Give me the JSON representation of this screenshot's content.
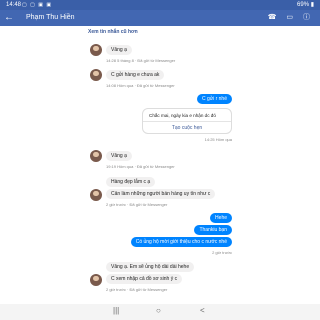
{
  "status": {
    "time": "14:48",
    "icons": "▢ ▢ ▣ ▣",
    "battery": "69% ▮"
  },
  "header": {
    "back_icon": "back-arrow-icon",
    "title": "Phạm Thu Hiền",
    "icons": "☎ ▭ ⓘ"
  },
  "older_link": "Xem tin nhắn cũ hơn",
  "messages": [
    {
      "text": "Vâng ạ",
      "meta": "14:28 5 tháng 8 · Đã gửi từ Messenger"
    },
    {
      "text": "C gửi hàng e chưa ak",
      "meta": "14:08 Hôm qua · Đã gửi từ Messenger"
    },
    {
      "text": "C gửi r nhé"
    },
    {
      "text": "Chắc mai, ngày kia e nhận dc đó",
      "meta": "14:25 Hôm qua"
    },
    {
      "text": "Tạo cuộc hẹn"
    },
    {
      "text": "Vâng ạ",
      "meta": "19:19 Hôm qua · Đã gửi từ Messenger"
    },
    {
      "text": "Hàng đẹp lắm c ạ"
    },
    {
      "text": "Cản làm những người bán hàng uy tín như c",
      "meta": "2 giờ trước · Đã gửi từ Messenger"
    },
    {
      "text": "Hehe"
    },
    {
      "text": "Thankiu bạn"
    },
    {
      "text": "Có ủng hộ mời giới thiệu cho c nước nhé",
      "meta": "2 giờ trước"
    },
    {
      "text": "Vâng ạ. Em sẽ ủng hộ dài dài hehe"
    },
    {
      "text": "C xem nhập cả đồ sơ sinh ý c",
      "meta": "2 giờ trước · Đã gửi từ Messenger"
    }
  ],
  "nav": {
    "recent": "|||",
    "home": "○",
    "back": "<"
  },
  "colors": {
    "header": "#4267b2",
    "outgoing": "#0084ff",
    "incoming": "#f1f0f0"
  }
}
